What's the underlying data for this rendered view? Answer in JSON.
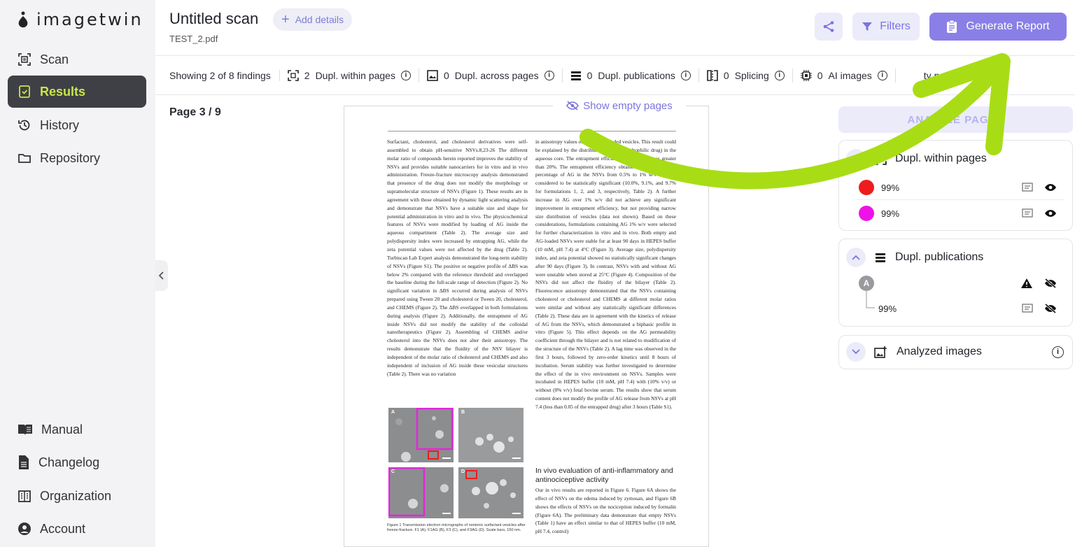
{
  "app": {
    "logo_text": "imagetwin"
  },
  "sidebar": {
    "items": [
      {
        "label": "Scan",
        "icon": "scan-icon",
        "active": false
      },
      {
        "label": "Results",
        "icon": "results-icon",
        "active": true
      },
      {
        "label": "History",
        "icon": "history-icon",
        "active": false
      },
      {
        "label": "Repository",
        "icon": "folder-icon",
        "active": false
      }
    ],
    "bottom_items": [
      {
        "label": "Manual",
        "icon": "book-icon"
      },
      {
        "label": "Changelog",
        "icon": "document-icon"
      },
      {
        "label": "Organization",
        "icon": "building-icon"
      },
      {
        "label": "Account",
        "icon": "user-icon"
      }
    ]
  },
  "header": {
    "title": "Untitled scan",
    "add_details": "Add details",
    "file_name": "TEST_2.pdf",
    "filters": "Filters",
    "generate_report": "Generate Report"
  },
  "findings": {
    "showing": "Showing 2 of 8 findings",
    "items": [
      {
        "count": "2",
        "label": "Dupl. within pages"
      },
      {
        "count": "0",
        "label": "Dupl. across pages"
      },
      {
        "count": "0",
        "label": "Dupl. publications"
      },
      {
        "count": "0",
        "label": "Splicing"
      },
      {
        "count": "0",
        "label": "AI images"
      }
    ],
    "last_partial": "ty pages"
  },
  "viewer": {
    "page_label": "Page 3 / 9",
    "show_empty": "Show empty pages",
    "col1": "Surfactant, cholesterol, and cholesterol derivatives were self-assembled to obtain pH-sensitive NSVs.8,23-26 The different molar ratio of compounds herein reported improves the stability of NSVs and provides suitable nanocarriers for in vitro and in vivo administration. Freeze-fracture microscopy analysis demonstrated that presence of the drug does not modify the morphology or supramolecular structure of NSVs (Figure 1). These results are in agreement with those obtained by dynamic light scattering analysis and demonstrate that NSVs have a suitable size and shape for potential administration in vitro and in vivo. The physicochemical features of NSVs were modified by loading of AG inside the aqueous compartment (Table 2). The average size and polydispersity index were increased by entrapping AG, while the zeta potential values were not affected by the drug (Table 2). Turbiscan Lab Expert analysis demonstrated the long-term stability of NSVs (Figure S1). The positive or negative profile of ΔBS was below 2% compared with the reference threshold and overlapped the baseline during the full-scale range of detection (Figure 2). No significant variation in ΔBS occurred during analysis of NSVs prepared using Tween 20 and cholesterol or Tween 20, cholesterol, and CHEMS (Figure 2). The ΔBS overlapped in both formulations during analysis (Figure 2). Additionally, the entrapment of AG inside NSVs did not modify the stability of the colloidal nanotherapeutics (Figure 2). Assembling of CHEMS and/or cholesterol into the NSVs does not alter their anisotropy. The results demonstrate that the fluidity of the NSV bilayer is independent of the molar ratio of cholesterol and CHEMS and also independent of inclusion of AG inside these vesicular structures (Table 2). There was no variation",
    "col2": "in anisotropy values of empty and loaded vesicles. This result could be explained by the distribution of AG (a hydrophilic drug) in the aqueous core. The entrapment efficiency of the NSVs was greater than 20%. The entrapment efficiency obtained by increasing the percentage of AG in the NSVs from 0.5% to 1% w/v was not considered to be statistically significant (10.0%, 9.1%, and 9.7% for formulations 1, 2, and 3, respectively, Table 2). A further increase in AG over 1% w/v did not achieve any significant improvement in entrapment efficiency, but not providing narrow size distribution of vesicles (data not shown). Based on these considerations, formulations containing AG 1% w/v were selected for further characterization in vitro and in vivo. Both empty and AG-loaded NSVs were stable for at least 90 days in HEPES buffer (10 mM, pH 7.4) at 4°C (Figure 3). Average size, polydispersity index, and zeta potential showed no statistically significant changes after 90 days (Figure 3). In contrast, NSVs with and without AG were unstable when stored at 25°C (Figure 4). Composition of the NSVs did not affect the fluidity of the bilayer (Table 2). Fluorescence anisotropy demonstrated that the NSVs containing cholesterol or cholesterol and CHEMS at different molar ratios were similar and without any statistically significant differences (Table 2). These data are in agreement with the kinetics of release of AG from the NSVs, which demonstrated a biphasic profile in vitro (Figure 5). This effect depends on the AG permeability coefficient through the bilayer and is not related to modification of the structure of the NSVs (Table 2). A lag time was observed in the first 3 hours, followed by zero-order kinetics until 8 hours of incubation. Serum stability was further investigated to determine the effect of the in vivo environment on NSVs. Samples were incubated in HEPES buffer (10 mM, pH 7.4) with (10% v/v) or without (0% v/v) fetal bovine serum. The results show that serum content does not modify the profile of AG release from NSVs at pH 7.4 (less than 0.05 of the entrapped drug) after 3 hours (Table S1).",
    "heading": "In vivo evaluation of anti-inflammatory and antinociceptive activity",
    "col2b": "Our in vivo results are reported in Figure 6. Figure 6A shows the effect of NSVs on the edema induced by zymosan, and Figure 6B shows the effects of NSVs on the nociception induced by formalin (Figure 6A). The preliminary data demonstrate that empty NSVs (Table 1) have an effect similar to that of HEPES buffer (10 mM, pH 7.4, control)",
    "figure_labels": [
      "A",
      "B",
      "C",
      "D"
    ],
    "caption": "Figure 1 Transmission electron micrographs of nonionic surfactant vesicles after freeze-fracture. F1 (A), F1AG (B), F3 (C), and F3AG (D). Scale bars, 150 nm."
  },
  "panel": {
    "analyze_label": "ANALYZE PAGES",
    "cards": [
      {
        "title": "Dupl. within pages",
        "rows": [
          {
            "score": "99%",
            "color": "#ee1c1c"
          },
          {
            "score": "99%",
            "color": "#ee12e8"
          }
        ]
      },
      {
        "title": "Dupl. publications",
        "avatar": "A",
        "rows": [
          {
            "score": "99%"
          }
        ]
      },
      {
        "title": "Analyzed images"
      }
    ]
  },
  "colors": {
    "accent": "#8a7fe6",
    "active_nav_bg": "#3f4046",
    "active_nav_text": "#c8e64a",
    "arrow": "#a8dd15"
  }
}
